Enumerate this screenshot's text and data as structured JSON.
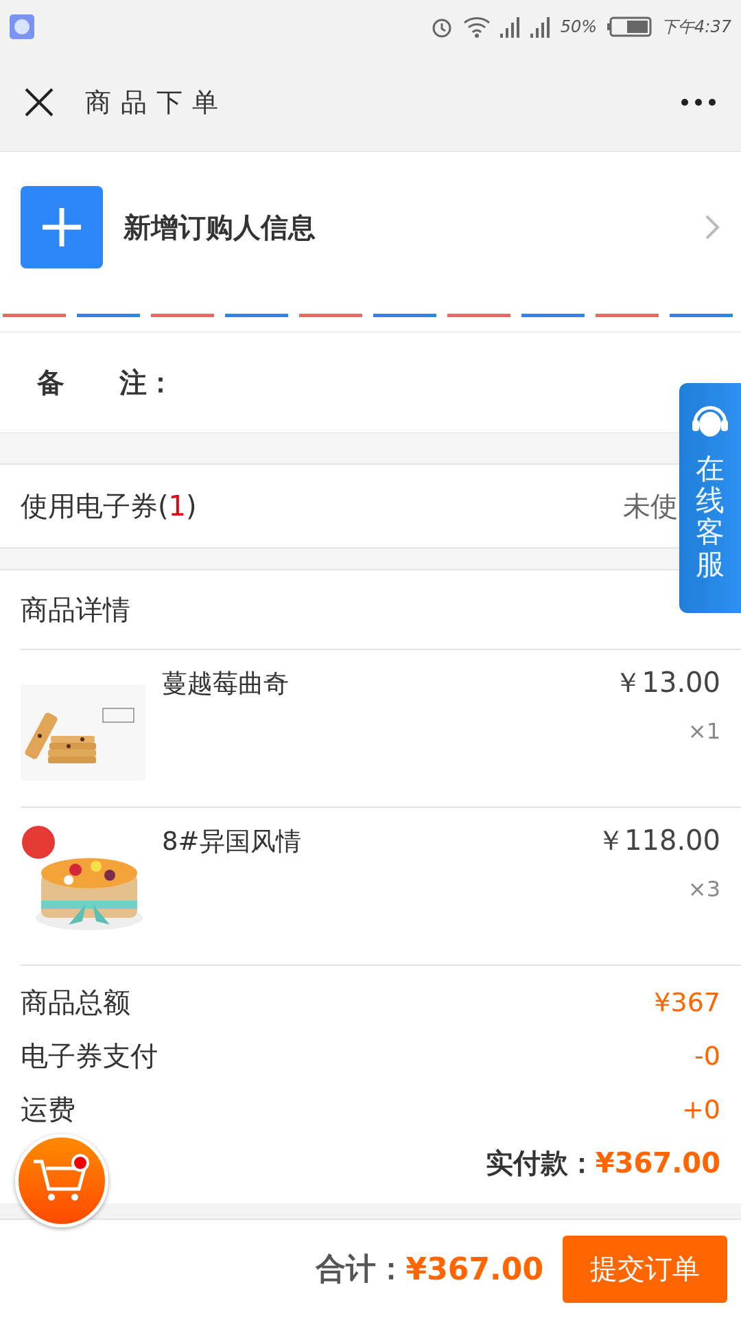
{
  "status_bar": {
    "battery_text": "50%",
    "time": "下午4:37"
  },
  "header": {
    "title": "商品下单"
  },
  "buyer": {
    "label": "新增订购人信息"
  },
  "remark": {
    "label": "备　　注："
  },
  "coupon": {
    "label_before": "使用电子券(",
    "count": "1",
    "label_after": ")",
    "status": "未使"
  },
  "details": {
    "title": "商品详情",
    "items": [
      {
        "name": "蔓越莓曲奇",
        "price": "￥13.00",
        "quantity": "×1",
        "kind": "cookie"
      },
      {
        "name": "8#异国风情",
        "price": "￥118.00",
        "quantity": "×3",
        "kind": "cake"
      }
    ]
  },
  "summary": {
    "rows": [
      {
        "label": "商品总额",
        "value": "¥367"
      },
      {
        "label": "电子券支付",
        "value": "-0"
      },
      {
        "label": "运费",
        "value": "+0"
      }
    ],
    "paid_label": "实付款：",
    "paid_value": "¥367.00"
  },
  "footer": {
    "total_label": "合计：",
    "total_value": "¥367.00",
    "submit": "提交订单"
  },
  "side_service": {
    "label": "在线客服"
  }
}
